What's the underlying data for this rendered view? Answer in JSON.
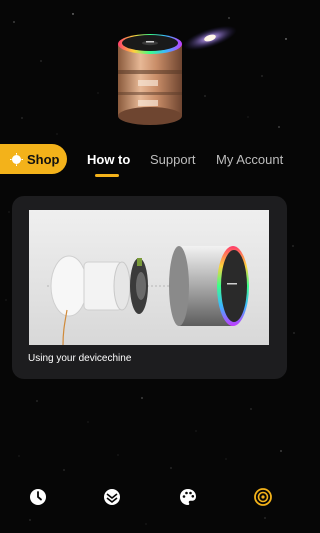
{
  "colors": {
    "background": "#060606",
    "accent": "#f3b21a",
    "card": "#1d1d1f",
    "tab_inactive": "#bdbdbd"
  },
  "header": {
    "hero_image": "rose-gold-device-with-galaxy"
  },
  "tabs": [
    {
      "label": "Shop",
      "icon": "sun-icon",
      "active": false,
      "highlighted": true
    },
    {
      "label": "How to",
      "active": true
    },
    {
      "label": "Support",
      "active": false
    },
    {
      "label": "My Account",
      "active": false
    }
  ],
  "card": {
    "image": "device-exploded-view",
    "caption": "Using your devicechine"
  },
  "bottom_nav": [
    {
      "icon": "clock-icon",
      "active": false
    },
    {
      "icon": "light-modes-icon",
      "active": false
    },
    {
      "icon": "palette-icon",
      "active": false
    },
    {
      "icon": "device-target-icon",
      "active": true
    }
  ]
}
